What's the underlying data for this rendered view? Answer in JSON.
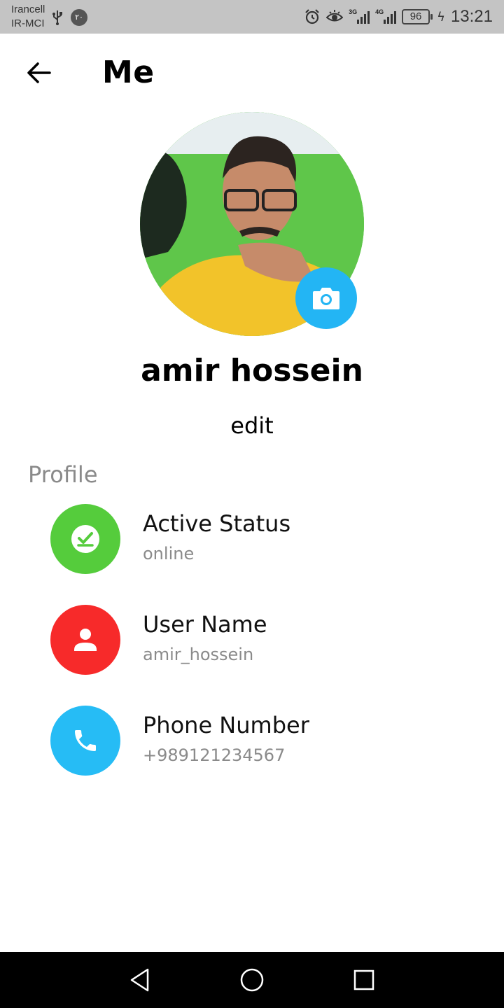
{
  "status_bar": {
    "carrier_1": "Irancell",
    "carrier_2": "IR-MCI",
    "notification_badge": "۲۰",
    "signal_1_label": "3G",
    "signal_2_label": "4G",
    "battery": "96",
    "time": "13:21"
  },
  "header": {
    "back_icon": "arrow-left-icon",
    "title": "Me"
  },
  "profile": {
    "display_name": "amir hossein",
    "edit_label": "edit",
    "camera_icon": "camera-icon"
  },
  "section": {
    "label": "Profile",
    "items": [
      {
        "title": "Active Status",
        "value": "online",
        "icon": "check-badge-icon",
        "color": "#55cc3c"
      },
      {
        "title": "User Name",
        "value": "amir_hossein",
        "icon": "person-icon",
        "color": "#f72a2a"
      },
      {
        "title": "Phone Number",
        "value": "+989121234567",
        "icon": "phone-icon",
        "color": "#26bcf5"
      }
    ]
  },
  "nav_bar": {
    "back_icon": "triangle-back-icon",
    "home_icon": "circle-home-icon",
    "recents_icon": "square-recents-icon"
  }
}
